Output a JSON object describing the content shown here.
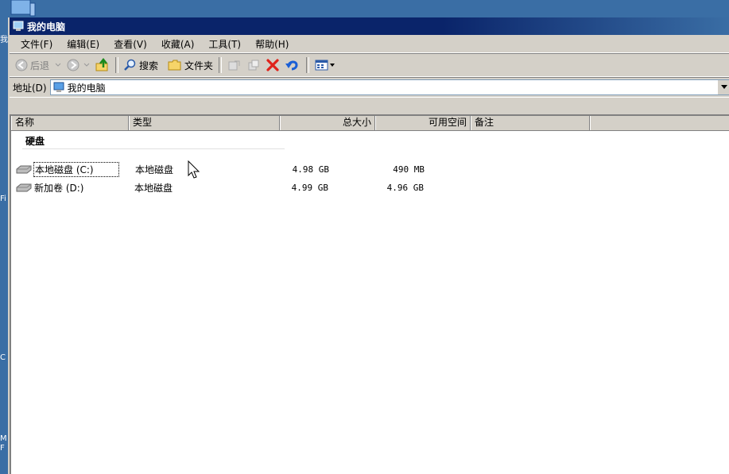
{
  "desktop": {
    "fragments": [
      "我",
      "Fi",
      "C",
      "M",
      "F"
    ]
  },
  "window": {
    "title": "我的电脑"
  },
  "menu": {
    "items": [
      "文件(F)",
      "编辑(E)",
      "查看(V)",
      "收藏(A)",
      "工具(T)",
      "帮助(H)"
    ]
  },
  "toolbar": {
    "back_label": "后退",
    "search_label": "搜索",
    "folders_label": "文件夹"
  },
  "address": {
    "label": "地址(D)",
    "value": "我的电脑"
  },
  "columns": [
    "名称",
    "类型",
    "总大小",
    "可用空间",
    "备注"
  ],
  "group": {
    "title": "硬盘"
  },
  "drives": [
    {
      "name": "本地磁盘 (C:)",
      "type": "本地磁盘",
      "total": "4.98 GB",
      "free": "490 MB",
      "selected": true
    },
    {
      "name": "新加卷 (D:)",
      "type": "本地磁盘",
      "total": "4.99 GB",
      "free": "4.96 GB",
      "selected": false
    }
  ],
  "colors": {
    "titlebar": "#0a246a",
    "desktop": "#3a6ea5",
    "chrome": "#d4d0c8",
    "delete_x": "#e0231b",
    "undo": "#1a5fd6"
  }
}
